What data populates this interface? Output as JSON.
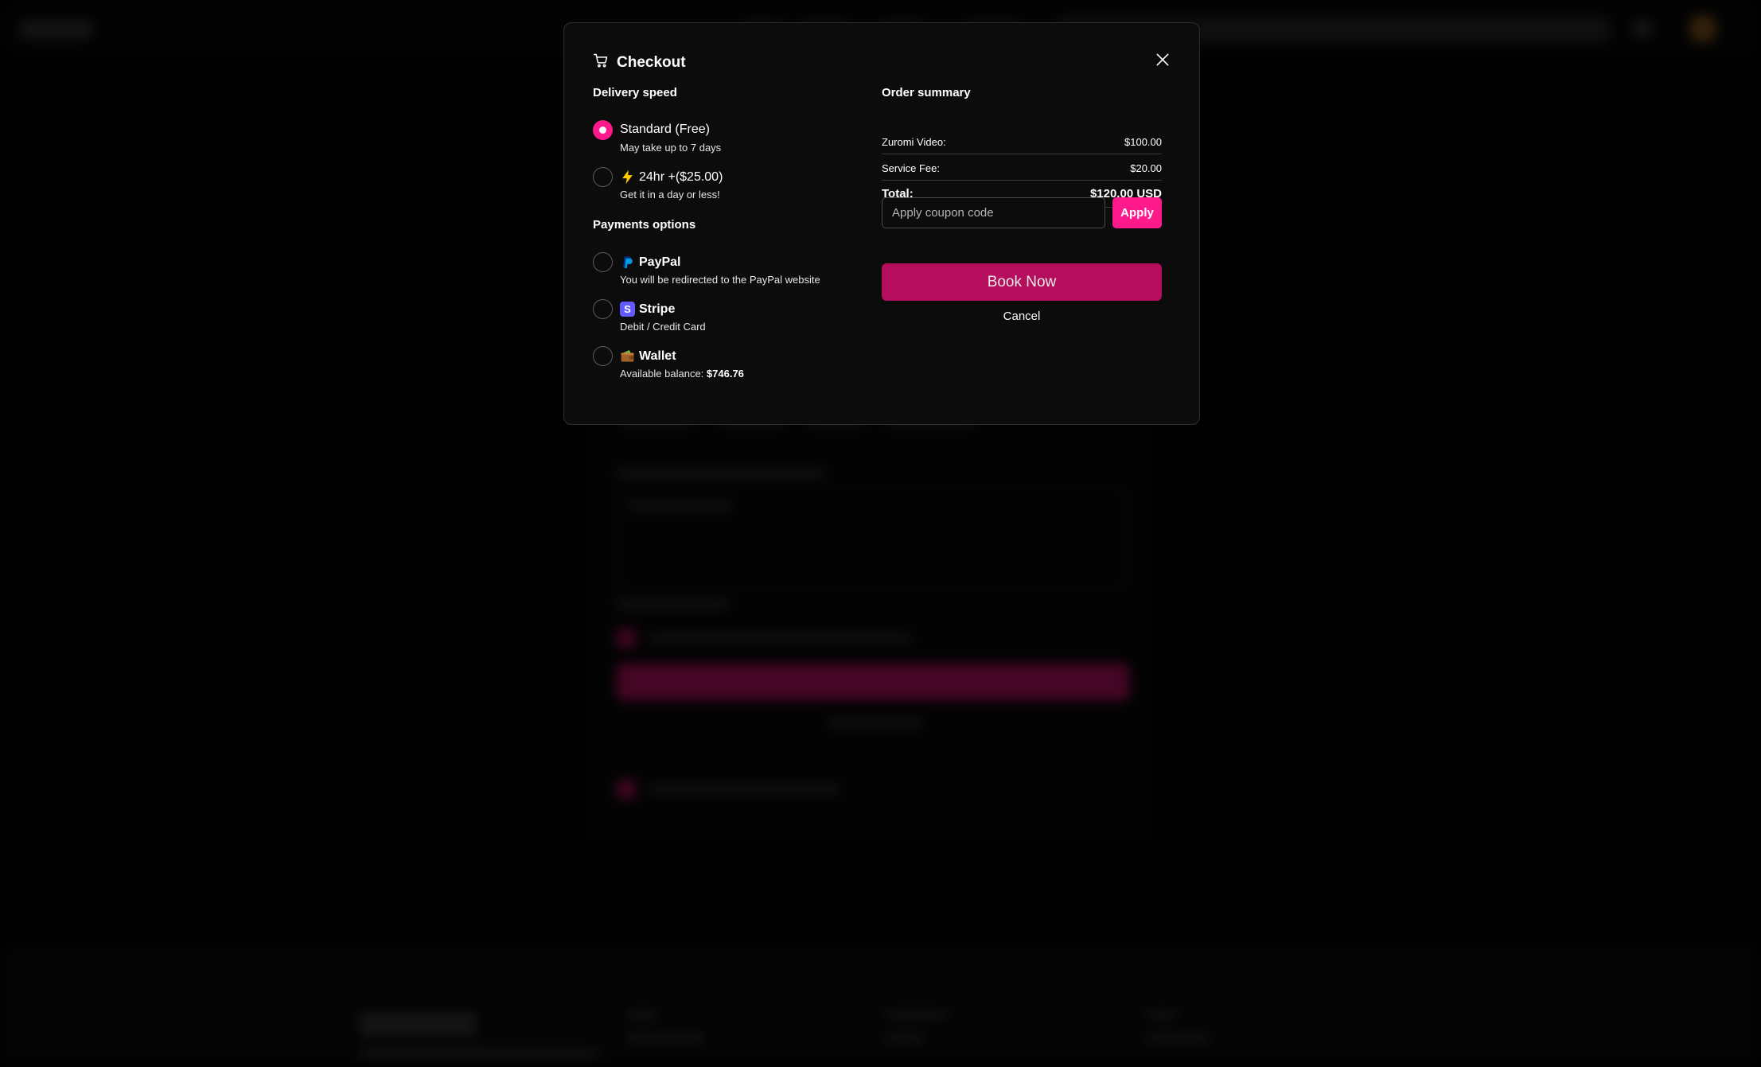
{
  "modal": {
    "title": "Checkout",
    "icon": "cart-icon",
    "close_icon": "close-icon"
  },
  "delivery": {
    "title": "Delivery speed",
    "options": [
      {
        "label": "Standard (Free)",
        "subtitle": "May take up to 7 days",
        "selected": true
      },
      {
        "label": "24hr +($25.00)",
        "subtitle": "Get it in a day or less!",
        "icon": "lightning-icon",
        "selected": false
      }
    ]
  },
  "payments": {
    "title": "Payments options",
    "options": [
      {
        "label": "PayPal",
        "subtitle": "You will be redirected to the PayPal website",
        "icon": "paypal-icon",
        "selected": false
      },
      {
        "label": "Stripe",
        "subtitle": "Debit / Credit Card",
        "icon": "stripe-icon",
        "icon_letter": "S",
        "selected": false
      },
      {
        "label": "Wallet",
        "subtitle_prefix": "Available balance: ",
        "balance": "$746.76",
        "icon": "wallet-icon",
        "selected": false
      }
    ]
  },
  "summary": {
    "title": "Order summary",
    "rows": [
      {
        "label": "Zuromi Video:",
        "value": "$100.00"
      },
      {
        "label": "Service Fee:",
        "value": "$20.00"
      }
    ],
    "total_label": "Total:",
    "total_value": "$120.00 USD"
  },
  "coupon": {
    "placeholder": "Apply coupon code",
    "value": "",
    "apply_label": "Apply"
  },
  "actions": {
    "book_label": "Book Now",
    "cancel_label": "Cancel"
  },
  "colors": {
    "accent": "#ff1a8c",
    "book_button": "#b40e5c",
    "modal_bg": "#0c0c0c",
    "stripe": "#635bff"
  }
}
